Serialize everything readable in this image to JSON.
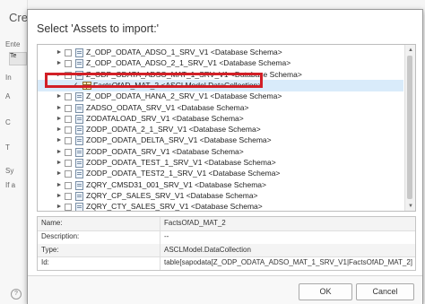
{
  "background": {
    "title": "Cre",
    "labels": [
      "Ente",
      "Te",
      "In",
      "A",
      "C",
      "T",
      "Sy",
      "If a"
    ]
  },
  "dialog": {
    "title": "Select 'Assets to import:'",
    "tree_items": [
      {
        "label": "Z_ODP_ODATA_ADSO_1_SRV_V1 <Database Schema>",
        "expander": "►",
        "checked": false,
        "icon": "database-schema-icon"
      },
      {
        "label": "Z_ODP_ODATA_ADSO_2_1_SRV_V1 <Database Schema>",
        "expander": "►",
        "checked": false,
        "icon": "database-schema-icon"
      },
      {
        "label": "Z_ODP_ODATA_ADSO_MAT_1_SRV_V1 <Database Schema>",
        "expander": "►",
        "checked": false,
        "icon": "database-schema-icon"
      },
      {
        "label": "FactsOfAD_MAT_2 <ASCLModel.DataCollection>",
        "expander": "",
        "checked": true,
        "icon": "data-collection-icon",
        "selected": true
      },
      {
        "label": "Z_ODP_ODATA_HANA_2_SRV_V1 <Database Schema>",
        "expander": "►",
        "checked": false,
        "icon": "database-schema-icon"
      },
      {
        "label": "ZADSO_ODATA_SRV_V1 <Database Schema>",
        "expander": "►",
        "checked": false,
        "icon": "database-schema-icon"
      },
      {
        "label": "ZODATALOAD_SRV_V1 <Database Schema>",
        "expander": "►",
        "checked": false,
        "icon": "database-schema-icon"
      },
      {
        "label": "ZODP_ODATA_2_1_SRV_V1 <Database Schema>",
        "expander": "►",
        "checked": false,
        "icon": "database-schema-icon"
      },
      {
        "label": "ZODP_ODATA_DELTA_SRV_V1 <Database Schema>",
        "expander": "►",
        "checked": false,
        "icon": "database-schema-icon"
      },
      {
        "label": "ZODP_ODATA_SRV_V1 <Database Schema>",
        "expander": "►",
        "checked": false,
        "icon": "database-schema-icon"
      },
      {
        "label": "ZODP_ODATA_TEST_1_SRV_V1 <Database Schema>",
        "expander": "►",
        "checked": false,
        "icon": "database-schema-icon"
      },
      {
        "label": "ZODP_ODATA_TEST2_1_SRV_V1 <Database Schema>",
        "expander": "►",
        "checked": false,
        "icon": "database-schema-icon"
      },
      {
        "label": "ZQRY_CMSD31_001_SRV_V1 <Database Schema>",
        "expander": "►",
        "checked": false,
        "icon": "database-schema-icon"
      },
      {
        "label": "ZQRY_CP_SALES_SRV_V1 <Database Schema>",
        "expander": "►",
        "checked": false,
        "icon": "database-schema-icon"
      },
      {
        "label": "ZQRY_CTY_SALES_SRV_V1 <Database Schema>",
        "expander": "►",
        "checked": false,
        "icon": "database-schema-icon"
      }
    ],
    "properties": [
      {
        "key": "Name:",
        "value": "FactsOfAD_MAT_2"
      },
      {
        "key": "Description:",
        "value": "--"
      },
      {
        "key": "Type:",
        "value": "ASCLModel.DataCollection"
      },
      {
        "key": "Id:",
        "value": "table[sapodata[Z_ODP_ODATA_ADSO_MAT_1_SRV_V1|FactsOfAD_MAT_2]"
      }
    ],
    "ok_label": "OK",
    "cancel_label": "Cancel",
    "highlight_color": "#d21f26"
  }
}
